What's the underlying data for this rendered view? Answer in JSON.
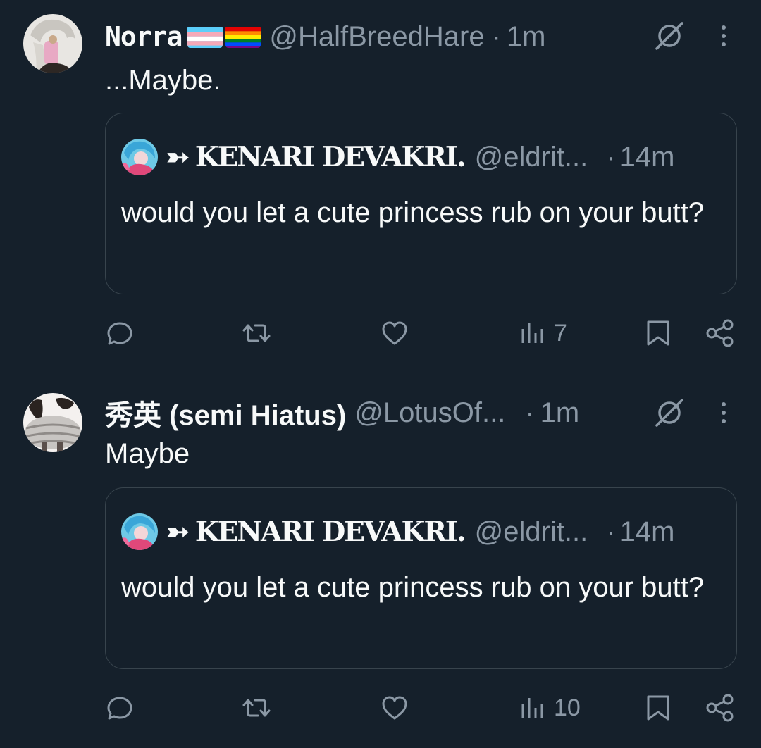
{
  "colors": {
    "background": "#15202b",
    "text_primary": "#f7f9f9",
    "text_secondary": "#8b98a5",
    "border": "#38444d"
  },
  "posts": [
    {
      "author": {
        "display_name": "Norra",
        "flags": [
          "transgender-flag-emoji",
          "rainbow-flag-emoji"
        ],
        "handle": "@HalfBreedHare",
        "separator": "·",
        "time": "1m"
      },
      "text": "...Maybe.",
      "quote": {
        "prefix": "➳",
        "display_name": "KENARI DEVAKRI.",
        "handle": "@eldrit...",
        "separator": "·",
        "time": "14m",
        "text": "would you let a cute princess rub on your butt?"
      },
      "actions": {
        "reply": "reply-icon",
        "repost": "repost-icon",
        "like": "heart-icon",
        "views": "7",
        "bookmark": "bookmark-icon",
        "share": "share-icon"
      }
    },
    {
      "author": {
        "display_name": "秀英 (semi Hiatus)",
        "handle": "@LotusOf...",
        "separator": "·",
        "time": "1m"
      },
      "text": "Maybe",
      "quote": {
        "prefix": "➳",
        "display_name": "KENARI DEVAKRI.",
        "handle": "@eldrit...",
        "separator": "·",
        "time": "14m",
        "text": "would you let a cute princess rub on your butt?"
      },
      "actions": {
        "reply": "reply-icon",
        "repost": "repost-icon",
        "like": "heart-icon",
        "views": "10",
        "bookmark": "bookmark-icon",
        "share": "share-icon"
      }
    }
  ]
}
